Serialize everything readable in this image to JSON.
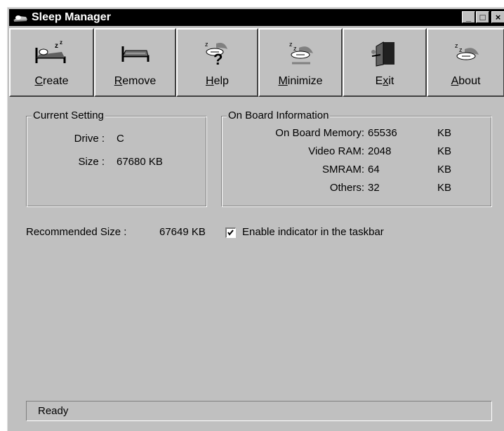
{
  "window": {
    "title": "Sleep Manager"
  },
  "title_buttons": {
    "minimize": "_",
    "maximize": "□",
    "close": "×"
  },
  "toolbar": {
    "create": {
      "pre": "",
      "u": "C",
      "post": "reate",
      "icon": "bed-sleep-icon"
    },
    "remove": {
      "pre": "",
      "u": "R",
      "post": "emove",
      "icon": "bed-remove-icon"
    },
    "help": {
      "pre": "",
      "u": "H",
      "post": "elp",
      "icon": "help-sleeper-icon"
    },
    "minimize": {
      "pre": "",
      "u": "M",
      "post": "inimize",
      "icon": "sleeper-icon"
    },
    "exit": {
      "pre": "E",
      "u": "x",
      "post": "it",
      "icon": "exit-door-icon"
    },
    "about": {
      "pre": "",
      "u": "A",
      "post": "bout",
      "icon": "about-sleeper-icon"
    }
  },
  "current_setting": {
    "legend": "Current Setting",
    "drive_label": "Drive :",
    "drive_value": "C",
    "size_label": "Size :",
    "size_value": "67680 KB"
  },
  "onboard": {
    "legend": "On Board Information",
    "rows": [
      {
        "label": "On Board Memory:",
        "value": "65536",
        "unit": "KB"
      },
      {
        "label": "Video RAM:",
        "value": "2048",
        "unit": "KB"
      },
      {
        "label": "SMRAM:",
        "value": "64",
        "unit": "KB"
      },
      {
        "label": "Others:",
        "value": "32",
        "unit": "KB"
      }
    ]
  },
  "recommended": {
    "label": "Recommended Size :",
    "value": "67649 KB"
  },
  "taskbar_indicator": {
    "label": "Enable indicator in the taskbar",
    "checked": true
  },
  "status": {
    "text": "Ready"
  }
}
